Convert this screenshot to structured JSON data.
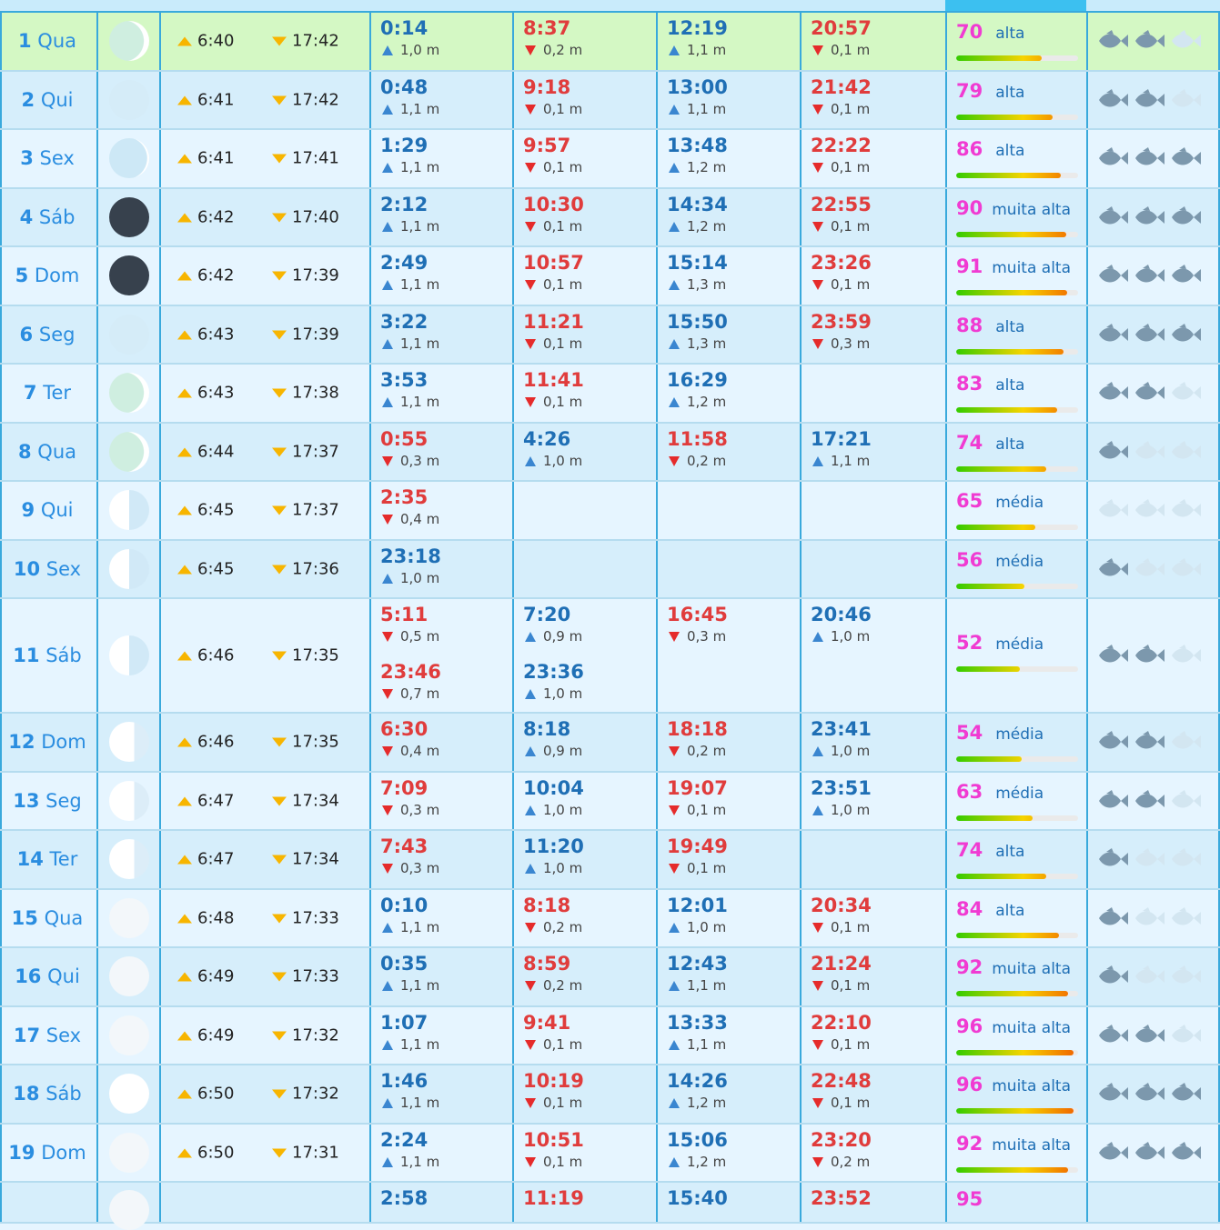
{
  "colors": {
    "high_time": "#1f6fb5",
    "low_time": "#e03c3c",
    "coef_value": "#f03bd2",
    "today_row": "#d4f8c4",
    "fish_on": "#7c98ad",
    "fish_off": "#d3e6f1"
  },
  "icons": {
    "sunrise": "sunrise-arrow-up-icon",
    "sunset": "sunset-arrow-down-icon",
    "high_tide": "high-tide-triangle-icon",
    "low_tide": "low-tide-triangle-icon",
    "fish": "fish-icon",
    "moon": "moon-phase-icon"
  },
  "rows": [
    {
      "day": "1",
      "weekday": "Qua",
      "moon": "waxing-crescent",
      "sunrise": "6:40",
      "sunset": "17:42",
      "coef": "70",
      "coef_label": "alta",
      "coef_level": 0.7,
      "fish": [
        1,
        1,
        0
      ],
      "today": true,
      "tides": [
        {
          "time": "0:14",
          "height": "1,0 m",
          "type": "high"
        },
        {
          "time": "8:37",
          "height": "0,2 m",
          "type": "low"
        },
        {
          "time": "12:19",
          "height": "1,1 m",
          "type": "high"
        },
        {
          "time": "20:57",
          "height": "0,1 m",
          "type": "low"
        }
      ]
    },
    {
      "day": "2",
      "weekday": "Qui",
      "moon": "new-light",
      "sunrise": "6:41",
      "sunset": "17:42",
      "coef": "79",
      "coef_label": "alta",
      "coef_level": 0.79,
      "fish": [
        1,
        1,
        0
      ],
      "tides": [
        {
          "time": "0:48",
          "height": "1,1 m",
          "type": "high"
        },
        {
          "time": "9:18",
          "height": "0,1 m",
          "type": "low"
        },
        {
          "time": "13:00",
          "height": "1,1 m",
          "type": "high"
        },
        {
          "time": "21:42",
          "height": "0,1 m",
          "type": "low"
        }
      ]
    },
    {
      "day": "3",
      "weekday": "Sex",
      "moon": "thin-crescent",
      "sunrise": "6:41",
      "sunset": "17:41",
      "coef": "86",
      "coef_label": "alta",
      "coef_level": 0.86,
      "fish": [
        1,
        1,
        1
      ],
      "tides": [
        {
          "time": "1:29",
          "height": "1,1 m",
          "type": "high"
        },
        {
          "time": "9:57",
          "height": "0,1 m",
          "type": "low"
        },
        {
          "time": "13:48",
          "height": "1,2 m",
          "type": "high"
        },
        {
          "time": "22:22",
          "height": "0,1 m",
          "type": "low"
        }
      ]
    },
    {
      "day": "4",
      "weekday": "Sáb",
      "moon": "new-dark",
      "sunrise": "6:42",
      "sunset": "17:40",
      "coef": "90",
      "coef_label": "muita alta",
      "coef_level": 0.9,
      "fish": [
        1,
        1,
        1
      ],
      "tides": [
        {
          "time": "2:12",
          "height": "1,1 m",
          "type": "high"
        },
        {
          "time": "10:30",
          "height": "0,1 m",
          "type": "low"
        },
        {
          "time": "14:34",
          "height": "1,2 m",
          "type": "high"
        },
        {
          "time": "22:55",
          "height": "0,1 m",
          "type": "low"
        }
      ]
    },
    {
      "day": "5",
      "weekday": "Dom",
      "moon": "new-dark",
      "sunrise": "6:42",
      "sunset": "17:39",
      "coef": "91",
      "coef_label": "muita alta",
      "coef_level": 0.91,
      "fish": [
        1,
        1,
        1
      ],
      "tides": [
        {
          "time": "2:49",
          "height": "1,1 m",
          "type": "high"
        },
        {
          "time": "10:57",
          "height": "0,1 m",
          "type": "low"
        },
        {
          "time": "15:14",
          "height": "1,3 m",
          "type": "high"
        },
        {
          "time": "23:26",
          "height": "0,1 m",
          "type": "low"
        }
      ]
    },
    {
      "day": "6",
      "weekday": "Seg",
      "moon": "new-light",
      "sunrise": "6:43",
      "sunset": "17:39",
      "coef": "88",
      "coef_label": "alta",
      "coef_level": 0.88,
      "fish": [
        1,
        1,
        1
      ],
      "tides": [
        {
          "time": "3:22",
          "height": "1,1 m",
          "type": "high"
        },
        {
          "time": "11:21",
          "height": "0,1 m",
          "type": "low"
        },
        {
          "time": "15:50",
          "height": "1,3 m",
          "type": "high"
        },
        {
          "time": "23:59",
          "height": "0,3 m",
          "type": "low"
        }
      ]
    },
    {
      "day": "7",
      "weekday": "Ter",
      "moon": "waxing-crescent",
      "sunrise": "6:43",
      "sunset": "17:38",
      "coef": "83",
      "coef_label": "alta",
      "coef_level": 0.83,
      "fish": [
        1,
        1,
        0
      ],
      "tides": [
        {
          "time": "3:53",
          "height": "1,1 m",
          "type": "high"
        },
        {
          "time": "11:41",
          "height": "0,1 m",
          "type": "low"
        },
        {
          "time": "16:29",
          "height": "1,2 m",
          "type": "high"
        }
      ]
    },
    {
      "day": "8",
      "weekday": "Qua",
      "moon": "waxing-crescent",
      "sunrise": "6:44",
      "sunset": "17:37",
      "coef": "74",
      "coef_label": "alta",
      "coef_level": 0.74,
      "fish": [
        1,
        0,
        0
      ],
      "tides": [
        {
          "time": "0:55",
          "height": "0,3 m",
          "type": "low"
        },
        {
          "time": "4:26",
          "height": "1,0 m",
          "type": "high"
        },
        {
          "time": "11:58",
          "height": "0,2 m",
          "type": "low"
        },
        {
          "time": "17:21",
          "height": "1,1 m",
          "type": "high"
        }
      ]
    },
    {
      "day": "9",
      "weekday": "Qui",
      "moon": "first-quarter",
      "sunrise": "6:45",
      "sunset": "17:37",
      "coef": "65",
      "coef_label": "média",
      "coef_level": 0.65,
      "fish": [
        0,
        0,
        0
      ],
      "tides": [
        {
          "time": "2:35",
          "height": "0,4 m",
          "type": "low"
        }
      ]
    },
    {
      "day": "10",
      "weekday": "Sex",
      "moon": "first-quarter",
      "sunrise": "6:45",
      "sunset": "17:36",
      "coef": "56",
      "coef_label": "média",
      "coef_level": 0.56,
      "fish": [
        1,
        0,
        0
      ],
      "tides": [
        {
          "time": "23:18",
          "height": "1,0 m",
          "type": "high"
        }
      ]
    },
    {
      "day": "11",
      "weekday": "Sáb",
      "moon": "first-quarter",
      "sunrise": "6:46",
      "sunset": "17:35",
      "coef": "52",
      "coef_label": "média",
      "coef_level": 0.52,
      "fish": [
        1,
        1,
        0
      ],
      "double": true,
      "tides": [
        {
          "time": "5:11",
          "height": "0,5 m",
          "type": "low"
        },
        {
          "time": "7:20",
          "height": "0,9 m",
          "type": "high"
        },
        {
          "time": "16:45",
          "height": "0,3 m",
          "type": "low"
        },
        {
          "time": "20:46",
          "height": "1,0 m",
          "type": "high"
        }
      ],
      "tides2": [
        {
          "time": "23:46",
          "height": "0,7 m",
          "type": "low"
        },
        {
          "time": "23:36",
          "height": "1,0 m",
          "type": "high"
        }
      ]
    },
    {
      "day": "12",
      "weekday": "Dom",
      "moon": "waxing-gibbous",
      "sunrise": "6:46",
      "sunset": "17:35",
      "coef": "54",
      "coef_label": "média",
      "coef_level": 0.54,
      "fish": [
        1,
        1,
        0
      ],
      "tides": [
        {
          "time": "6:30",
          "height": "0,4 m",
          "type": "low"
        },
        {
          "time": "8:18",
          "height": "0,9 m",
          "type": "high"
        },
        {
          "time": "18:18",
          "height": "0,2 m",
          "type": "low"
        },
        {
          "time": "23:41",
          "height": "1,0 m",
          "type": "high"
        }
      ]
    },
    {
      "day": "13",
      "weekday": "Seg",
      "moon": "waxing-gibbous",
      "sunrise": "6:47",
      "sunset": "17:34",
      "coef": "63",
      "coef_label": "média",
      "coef_level": 0.63,
      "fish": [
        1,
        1,
        0
      ],
      "tides": [
        {
          "time": "7:09",
          "height": "0,3 m",
          "type": "low"
        },
        {
          "time": "10:04",
          "height": "1,0 m",
          "type": "high"
        },
        {
          "time": "19:07",
          "height": "0,1 m",
          "type": "low"
        },
        {
          "time": "23:51",
          "height": "1,0 m",
          "type": "high"
        }
      ]
    },
    {
      "day": "14",
      "weekday": "Ter",
      "moon": "waxing-gibbous",
      "sunrise": "6:47",
      "sunset": "17:34",
      "coef": "74",
      "coef_label": "alta",
      "coef_level": 0.74,
      "fish": [
        1,
        0,
        0
      ],
      "tides": [
        {
          "time": "7:43",
          "height": "0,3 m",
          "type": "low"
        },
        {
          "time": "11:20",
          "height": "1,0 m",
          "type": "high"
        },
        {
          "time": "19:49",
          "height": "0,1 m",
          "type": "low"
        }
      ]
    },
    {
      "day": "15",
      "weekday": "Qua",
      "moon": "near-full",
      "sunrise": "6:48",
      "sunset": "17:33",
      "coef": "84",
      "coef_label": "alta",
      "coef_level": 0.84,
      "fish": [
        1,
        0,
        0
      ],
      "tides": [
        {
          "time": "0:10",
          "height": "1,1 m",
          "type": "high"
        },
        {
          "time": "8:18",
          "height": "0,2 m",
          "type": "low"
        },
        {
          "time": "12:01",
          "height": "1,0 m",
          "type": "high"
        },
        {
          "time": "20:34",
          "height": "0,1 m",
          "type": "low"
        }
      ]
    },
    {
      "day": "16",
      "weekday": "Qui",
      "moon": "near-full",
      "sunrise": "6:49",
      "sunset": "17:33",
      "coef": "92",
      "coef_label": "muita alta",
      "coef_level": 0.92,
      "fish": [
        1,
        0,
        0
      ],
      "tides": [
        {
          "time": "0:35",
          "height": "1,1 m",
          "type": "high"
        },
        {
          "time": "8:59",
          "height": "0,2 m",
          "type": "low"
        },
        {
          "time": "12:43",
          "height": "1,1 m",
          "type": "high"
        },
        {
          "time": "21:24",
          "height": "0,1 m",
          "type": "low"
        }
      ]
    },
    {
      "day": "17",
      "weekday": "Sex",
      "moon": "near-full",
      "sunrise": "6:49",
      "sunset": "17:32",
      "coef": "96",
      "coef_label": "muita alta",
      "coef_level": 0.96,
      "fish": [
        1,
        1,
        0
      ],
      "tides": [
        {
          "time": "1:07",
          "height": "1,1 m",
          "type": "high"
        },
        {
          "time": "9:41",
          "height": "0,1 m",
          "type": "low"
        },
        {
          "time": "13:33",
          "height": "1,1 m",
          "type": "high"
        },
        {
          "time": "22:10",
          "height": "0,1 m",
          "type": "low"
        }
      ]
    },
    {
      "day": "18",
      "weekday": "Sáb",
      "moon": "full",
      "sunrise": "6:50",
      "sunset": "17:32",
      "coef": "96",
      "coef_label": "muita alta",
      "coef_level": 0.96,
      "fish": [
        1,
        1,
        1
      ],
      "tides": [
        {
          "time": "1:46",
          "height": "1,1 m",
          "type": "high"
        },
        {
          "time": "10:19",
          "height": "0,1 m",
          "type": "low"
        },
        {
          "time": "14:26",
          "height": "1,2 m",
          "type": "high"
        },
        {
          "time": "22:48",
          "height": "0,1 m",
          "type": "low"
        }
      ]
    },
    {
      "day": "19",
      "weekday": "Dom",
      "moon": "near-full",
      "sunrise": "6:50",
      "sunset": "17:31",
      "coef": "92",
      "coef_label": "muita alta",
      "coef_level": 0.92,
      "fish": [
        1,
        1,
        1
      ],
      "tides": [
        {
          "time": "2:24",
          "height": "1,1 m",
          "type": "high"
        },
        {
          "time": "10:51",
          "height": "0,1 m",
          "type": "low"
        },
        {
          "time": "15:06",
          "height": "1,2 m",
          "type": "high"
        },
        {
          "time": "23:20",
          "height": "0,2 m",
          "type": "low"
        }
      ]
    },
    {
      "day": "",
      "weekday": "",
      "moon": "near-full",
      "sunrise": "",
      "sunset": "",
      "coef": "95",
      "coef_label": "",
      "coef_level": 0.95,
      "fish": [
        0,
        0,
        0
      ],
      "partial": true,
      "tides": [
        {
          "time": "2:58",
          "height": "",
          "type": "high"
        },
        {
          "time": "11:19",
          "height": "",
          "type": "low"
        },
        {
          "time": "15:40",
          "height": "",
          "type": "high"
        },
        {
          "time": "23:52",
          "height": "",
          "type": "low"
        }
      ]
    }
  ]
}
